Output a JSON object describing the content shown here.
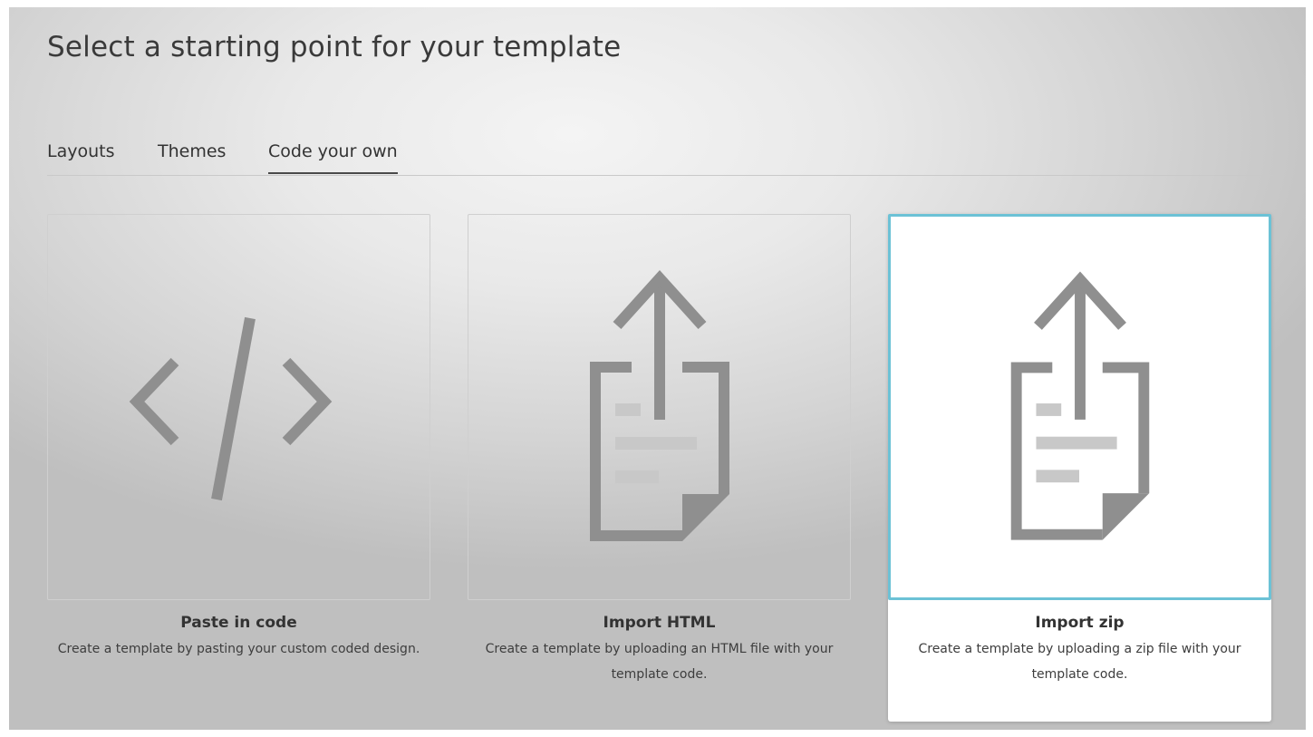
{
  "page": {
    "title": "Select a starting point for your template"
  },
  "tabs": [
    {
      "label": "Layouts",
      "active": false
    },
    {
      "label": "Themes",
      "active": false
    },
    {
      "label": "Code your own",
      "active": true
    }
  ],
  "cards": [
    {
      "title": "Paste in code",
      "description": "Create a template by pasting your custom coded design.",
      "icon": "code-icon",
      "selected": false
    },
    {
      "title": "Import HTML",
      "description": "Create a template by uploading an HTML file with your template code.",
      "icon": "upload-file-icon",
      "selected": false
    },
    {
      "title": "Import zip",
      "description": "Create a template by uploading a zip file with your template code.",
      "icon": "upload-file-icon",
      "selected": true
    }
  ],
  "colors": {
    "selected_border": "#6cc2d6",
    "icon_gray": "#8f8f8f",
    "icon_light_gray": "#c8c8c8",
    "active_tab_underline": "#4a4a4a"
  }
}
